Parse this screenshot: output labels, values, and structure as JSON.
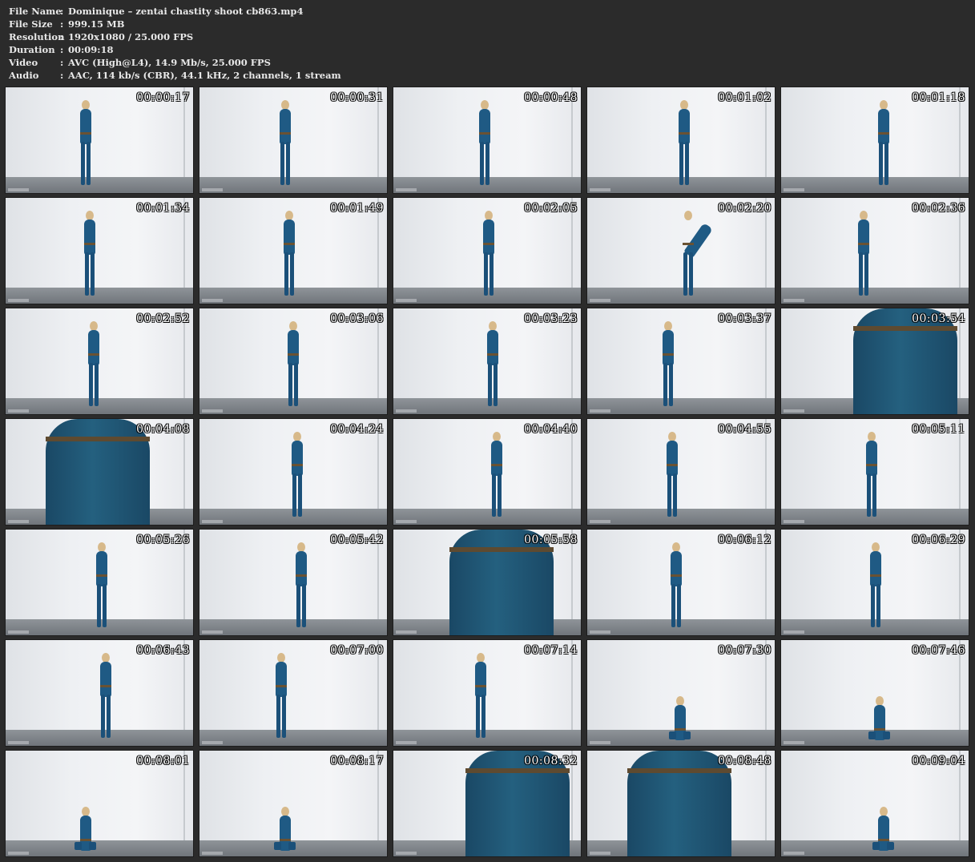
{
  "info": [
    {
      "key": "File Name",
      "sep": ":",
      "value": "Dominique – zentai chastity shoot cb863.mp4"
    },
    {
      "key": "File Size",
      "sep": ":",
      "value": "999.15 MB"
    },
    {
      "key": "Resolution",
      "sep": ":",
      "value": "1920x1080 / 25.000 FPS"
    },
    {
      "key": "Duration",
      "sep": ":",
      "value": "00:09:18"
    },
    {
      "key": "Video",
      "sep": ":",
      "value": "AVC (High@L4), 14.9 Mb/s, 25.000 FPS"
    },
    {
      "key": "Audio",
      "sep": ":",
      "value": "AAC, 114 kb/s (CBR), 44.1 kHz, 2 channels, 1 stream"
    }
  ],
  "thumbnails": [
    {
      "time": "00:00:17",
      "pose": "stand"
    },
    {
      "time": "00:00:31",
      "pose": "stand"
    },
    {
      "time": "00:00:48",
      "pose": "stand"
    },
    {
      "time": "00:01:02",
      "pose": "stand"
    },
    {
      "time": "00:01:18",
      "pose": "stand"
    },
    {
      "time": "00:01:34",
      "pose": "stand"
    },
    {
      "time": "00:01:49",
      "pose": "stand"
    },
    {
      "time": "00:02:05",
      "pose": "stand"
    },
    {
      "time": "00:02:20",
      "pose": "bend"
    },
    {
      "time": "00:02:36",
      "pose": "stand"
    },
    {
      "time": "00:02:52",
      "pose": "stand"
    },
    {
      "time": "00:03:06",
      "pose": "stand"
    },
    {
      "time": "00:03:23",
      "pose": "stand"
    },
    {
      "time": "00:03:37",
      "pose": "stand"
    },
    {
      "time": "00:03:54",
      "pose": "closeup"
    },
    {
      "time": "00:04:08",
      "pose": "closeup"
    },
    {
      "time": "00:04:24",
      "pose": "stand"
    },
    {
      "time": "00:04:40",
      "pose": "stand"
    },
    {
      "time": "00:04:55",
      "pose": "stand"
    },
    {
      "time": "00:05:11",
      "pose": "stand"
    },
    {
      "time": "00:05:26",
      "pose": "stand"
    },
    {
      "time": "00:05:42",
      "pose": "stand"
    },
    {
      "time": "00:05:58",
      "pose": "closeup"
    },
    {
      "time": "00:06:12",
      "pose": "stand"
    },
    {
      "time": "00:06:29",
      "pose": "stand"
    },
    {
      "time": "00:06:43",
      "pose": "stand"
    },
    {
      "time": "00:07:00",
      "pose": "stand"
    },
    {
      "time": "00:07:14",
      "pose": "stand"
    },
    {
      "time": "00:07:30",
      "pose": "kneel"
    },
    {
      "time": "00:07:46",
      "pose": "kneel"
    },
    {
      "time": "00:08:01",
      "pose": "kneel"
    },
    {
      "time": "00:08:17",
      "pose": "kneel"
    },
    {
      "time": "00:08:32",
      "pose": "closeup"
    },
    {
      "time": "00:08:48",
      "pose": "closeup"
    },
    {
      "time": "00:09:04",
      "pose": "kneel"
    }
  ],
  "colors": {
    "background": "#2b2b2b",
    "text": "#e8e8e8",
    "timestamp": "#ffffff",
    "suit": "#1f5a84"
  }
}
